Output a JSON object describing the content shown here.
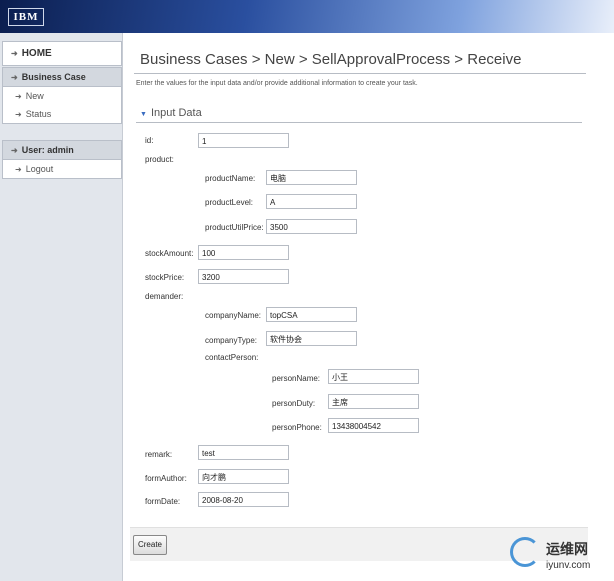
{
  "header": {
    "logo": "IBM"
  },
  "sidebar": {
    "home": "HOME",
    "section1": "Business Case",
    "items1": [
      "New",
      "Status"
    ],
    "section2": "User: admin",
    "items2": [
      "Logout"
    ]
  },
  "main": {
    "breadcrumb": "Business Cases > New > SellApprovalProcess > Receive",
    "instructions": "Enter the values for the input data and/or provide additional information to create your task.",
    "section_title": "Input Data"
  },
  "form": {
    "id_label": "id:",
    "id_value": "1",
    "product_label": "product:",
    "productName_label": "productName:",
    "productName_value": "电脑",
    "productLevel_label": "productLevel:",
    "productLevel_value": "A",
    "productUtilPrice_label": "productUtilPrice:",
    "productUtilPrice_value": "3500",
    "stockAmount_label": "stockAmount:",
    "stockAmount_value": "100",
    "stockPrice_label": "stockPrice:",
    "stockPrice_value": "3200",
    "demander_label": "demander:",
    "companyName_label": "companyName:",
    "companyName_value": "topCSA",
    "companyType_label": "companyType:",
    "companyType_value": "软件协会",
    "contactPerson_label": "contactPerson:",
    "personName_label": "personName:",
    "personName_value": "小王",
    "personDuty_label": "personDuty:",
    "personDuty_value": "主席",
    "personPhone_label": "personPhone:",
    "personPhone_value": "13438004542",
    "remark_label": "remark:",
    "remark_value": "test",
    "formAuthor_label": "formAuthor:",
    "formAuthor_value": "向才鹏",
    "formDate_label": "formDate:",
    "formDate_value": "2008-08-20"
  },
  "actions": {
    "create": "Create"
  },
  "watermark": {
    "name": "运维网",
    "url": "iyunv.com"
  }
}
